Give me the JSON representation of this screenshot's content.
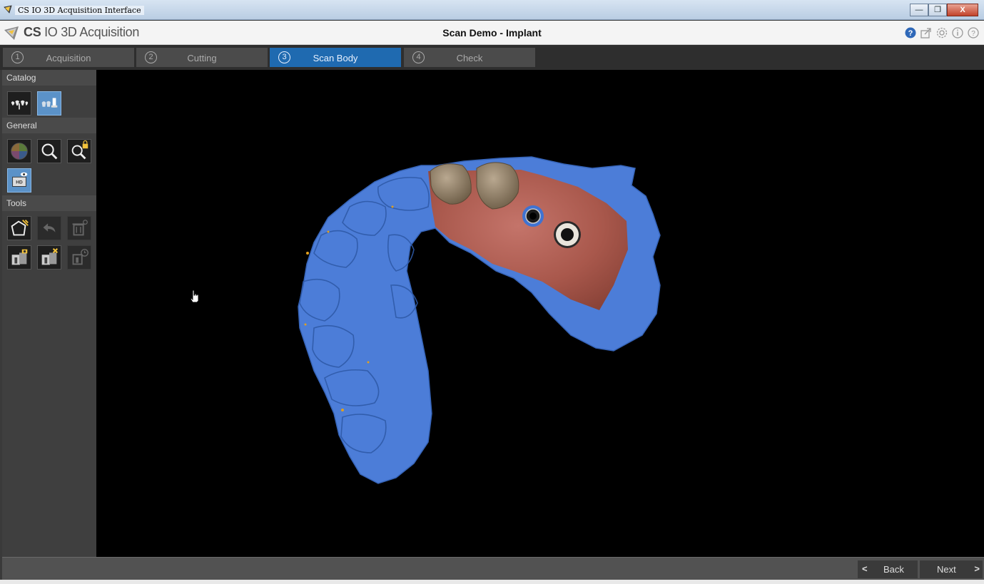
{
  "window": {
    "title": "CS IO 3D Acquisition Interface",
    "controls": {
      "minimize": "—",
      "restore": "❐",
      "close": "X"
    }
  },
  "app": {
    "brand_bold": "CS",
    "brand_rest": " IO 3D Acquisition",
    "document_title": "Scan Demo - Implant",
    "header_icons": [
      "help-icon",
      "export-icon",
      "settings-icon",
      "info-icon",
      "question-icon"
    ]
  },
  "steps": [
    {
      "num": "1",
      "label": "Acquisition",
      "active": false
    },
    {
      "num": "2",
      "label": "Cutting",
      "active": false
    },
    {
      "num": "3",
      "label": "Scan Body",
      "active": true
    },
    {
      "num": "4",
      "label": "Check",
      "active": false
    }
  ],
  "left_panel": {
    "catalog_label": "Catalog",
    "general_label": "General",
    "tools_label": "Tools",
    "catalog_tools": [
      "arch-view-icon",
      "scan-body-catalog-icon"
    ],
    "general_tools": [
      "color-wheel-icon",
      "zoom-fit-icon",
      "zoom-lock-icon",
      "hd-view-icon"
    ],
    "tools": [
      "polygon-cut-icon",
      "undo-icon",
      "delete-icon",
      "capture-icon",
      "remove-capture-icon",
      "history-icon"
    ]
  },
  "navigation": {
    "back_label": "Back",
    "next_label": "Next",
    "back_arrow": "<",
    "next_arrow": ">"
  },
  "colors": {
    "active_step": "#1f6ab0",
    "scan_blue": "#4f7fd9",
    "scan_tissue": "#b86456",
    "viewport_bg": "#000000"
  }
}
